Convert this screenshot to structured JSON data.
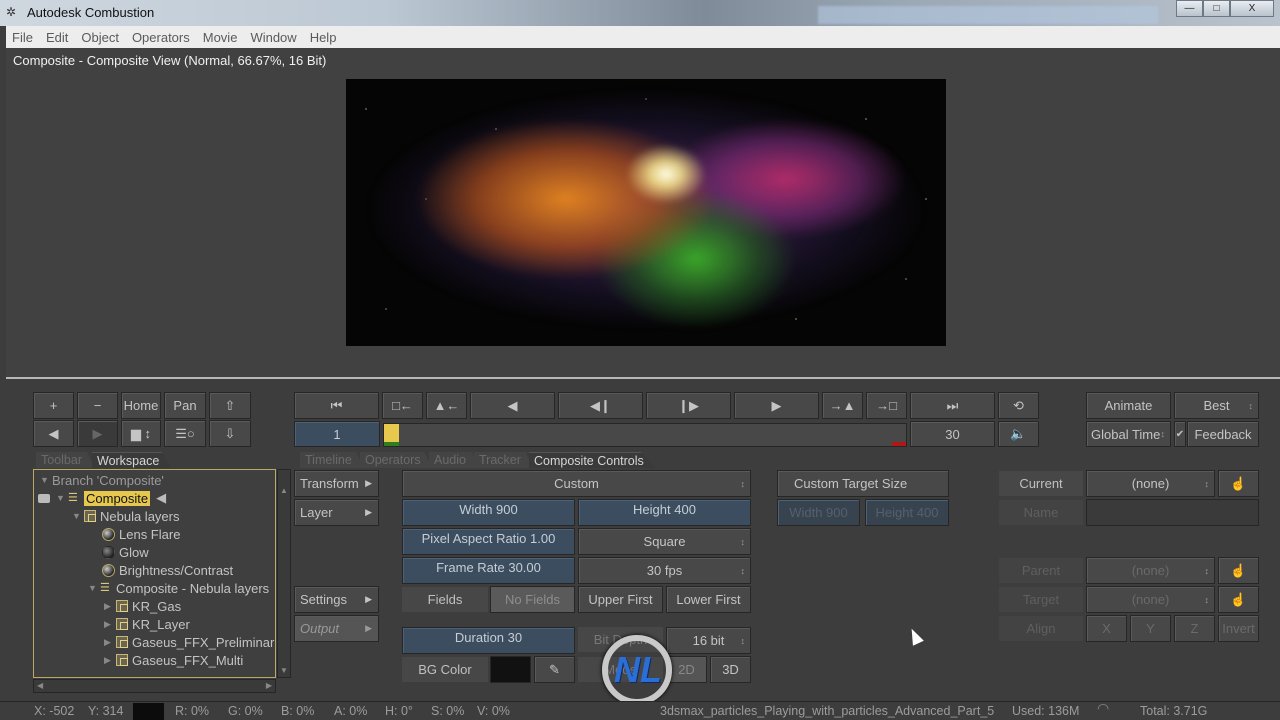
{
  "window": {
    "title": "Autodesk Combustion",
    "buttons": {
      "minimize": "—",
      "maximize": "□",
      "close": "X"
    }
  },
  "menu": [
    "File",
    "Edit",
    "Object",
    "Operators",
    "Movie",
    "Window",
    "Help"
  ],
  "viewer": {
    "title": "Composite - Composite View (Normal, 66.67%, 16 Bit)"
  },
  "nav_toolbar": {
    "plus": "+",
    "minus": "−",
    "home": "Home",
    "pan": "Pan"
  },
  "transport": {
    "current_frame": "1",
    "end_frame": "30",
    "animate": "Animate",
    "quality": "Best",
    "time_mode": "Global Time",
    "feedback": "Feedback",
    "feedback_checked": true,
    "playhead_fraction": 0.0
  },
  "left_tabs": [
    {
      "label": "Toolbar",
      "active": false
    },
    {
      "label": "Workspace",
      "active": true
    }
  ],
  "panel_tabs": [
    {
      "label": "Timeline",
      "active": false
    },
    {
      "label": "Operators",
      "active": false
    },
    {
      "label": "Audio",
      "active": false
    },
    {
      "label": "Tracker",
      "active": false
    },
    {
      "label": "Composite Controls",
      "active": true
    }
  ],
  "tree": {
    "items": [
      {
        "label": "Branch 'Composite'",
        "type": "branch"
      },
      {
        "label": "Composite",
        "type": "composite",
        "selected": true
      },
      {
        "label": "Nebula layers",
        "type": "layer"
      },
      {
        "label": "Lens Flare",
        "type": "operator"
      },
      {
        "label": "Glow",
        "type": "operator-off"
      },
      {
        "label": "Brightness/Contrast",
        "type": "operator"
      },
      {
        "label": "Composite - Nebula layers",
        "type": "composite"
      },
      {
        "label": "KR_Gas",
        "type": "layer"
      },
      {
        "label": "KR_Layer",
        "type": "layer"
      },
      {
        "label": "Gaseus_FFX_Preliminar",
        "type": "layer"
      },
      {
        "label": "Gaseus_FFX_Multi",
        "type": "layer"
      }
    ]
  },
  "side_menu": {
    "transform": "Transform",
    "layer": "Layer",
    "settings": "Settings",
    "output": "Output"
  },
  "composite_controls": {
    "preset": "Custom",
    "width": "Width 900",
    "height": "Height 400",
    "pixel_aspect": "Pixel Aspect Ratio 1.00",
    "pixel_aspect_preset": "Square",
    "frame_rate": "Frame Rate 30.00",
    "fps_preset": "30 fps",
    "fields_label": "Fields",
    "fields_options": [
      "No Fields",
      "Upper First",
      "Lower First"
    ],
    "fields_selected": "No Fields",
    "duration": "Duration 30",
    "bit_depth_label": "Bit Depth",
    "bit_depth": "16 bit",
    "bg_color_label": "BG Color",
    "bg_color": "#111111",
    "mode_label": "Mode",
    "mode_options": [
      "2D",
      "3D"
    ],
    "mode_selected": "2D",
    "custom_target_size": "Custom Target Size",
    "target_width": "Width 900",
    "target_height": "Height 400"
  },
  "camera_controls": {
    "current_label": "Current",
    "current_value": "(none)",
    "name_label": "Name",
    "name_value": "",
    "parent_label": "Parent",
    "parent_value": "(none)",
    "target_label": "Target",
    "target_value": "(none)",
    "align_label": "Align",
    "align_buttons": [
      "X",
      "Y",
      "Z",
      "Invert"
    ]
  },
  "statusbar": {
    "x": "X:  -502",
    "y": "Y:  314",
    "r": "R: 0%",
    "g": "G: 0%",
    "b": "B: 0%",
    "a": "A: 0%",
    "h": "H: 0°",
    "s": "S: 0%",
    "v": "V: 0%",
    "filename": "3dsmax_particles_Playing_with_particles_Advanced_Part_5",
    "used": "Used: 136M",
    "total": "Total: 3.71G"
  },
  "colors": {
    "accent_selection": "#e6c84f",
    "slider_blue": "#3b4d5f",
    "panel_bg": "#3d3d3d"
  }
}
